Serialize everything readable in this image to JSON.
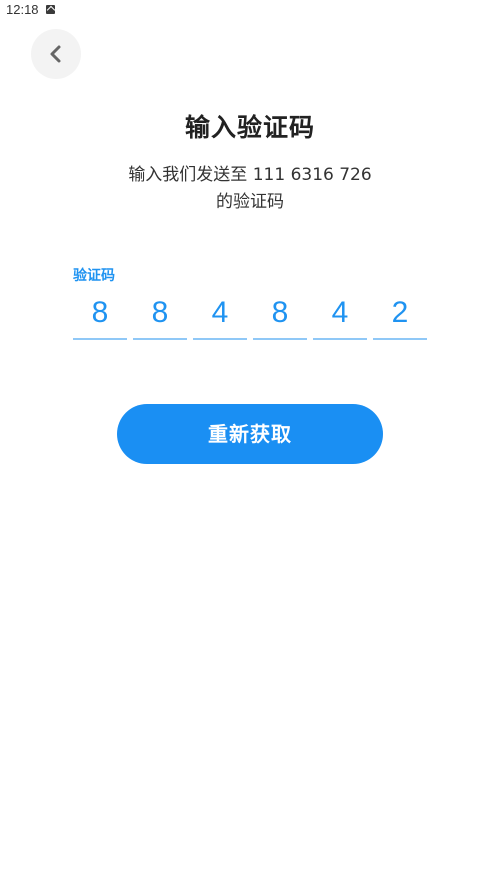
{
  "status_bar": {
    "time": "12:18",
    "notification_icon": "app-notification-icon"
  },
  "header": {
    "back_icon": "chevron-left-icon"
  },
  "main": {
    "title": "输入验证码",
    "subtitle_line1": "输入我们发送至 111 6316 726",
    "subtitle_line2": "的验证码",
    "code_label": "验证码",
    "code_digits": [
      "8",
      "8",
      "4",
      "8",
      "4",
      "2"
    ],
    "resend_label": "重新获取"
  },
  "colors": {
    "accent": "#1a8ff3",
    "underline": "#8fc8f7",
    "back_button_bg": "#f3f3f3",
    "title_text": "#222222"
  }
}
